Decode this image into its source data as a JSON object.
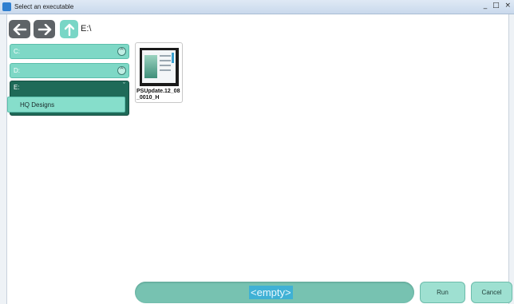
{
  "window": {
    "title": "Select an executable",
    "controls": [
      "_",
      "□",
      "×"
    ]
  },
  "toolbar": {
    "back_icon": "arrow-left-icon",
    "forward_icon": "arrow-right-icon",
    "up_icon": "arrow-up-icon",
    "current_path": "E:\\"
  },
  "drives": {
    "c": {
      "label": "C:",
      "toggle": "^"
    },
    "d": {
      "label": "D:",
      "toggle": "^"
    },
    "e": {
      "label": "E:",
      "toggle": "ˇ",
      "folders": [
        {
          "label": "HQ Designs"
        }
      ]
    }
  },
  "files": [
    {
      "name": "PSUpdate.12_08_0010_H"
    }
  ],
  "selection": {
    "text": "<empty>"
  },
  "buttons": {
    "run": "Run",
    "cancel": "Cancel"
  },
  "colors": {
    "accent_teal": "#7ed8c6",
    "expanded_drive": "#1f6a58",
    "selection_bar": "#77c2b1",
    "selection_highlight": "#3fb1d5",
    "nav_button": "#5e6367"
  }
}
